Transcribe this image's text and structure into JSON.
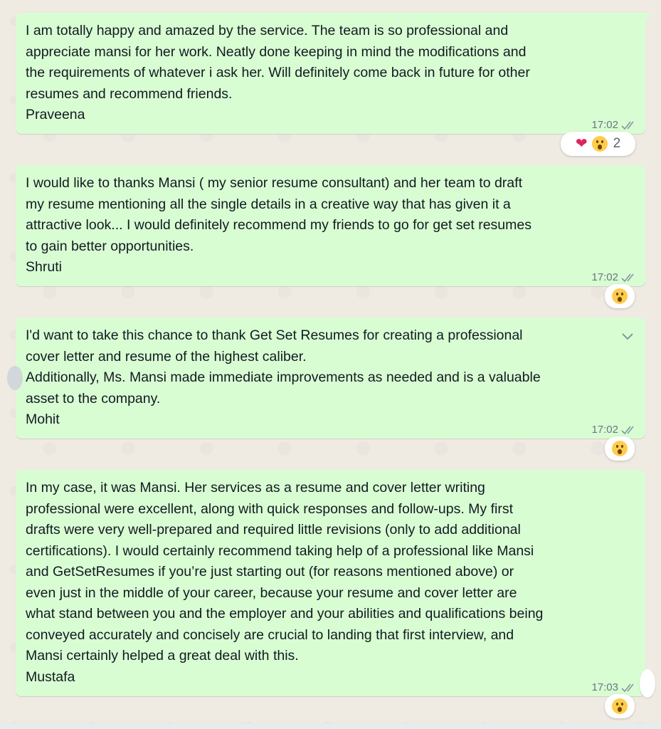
{
  "colors": {
    "bubble_out": "#d9fdd3",
    "chat_background": "#efeae2",
    "meta_text": "#667781",
    "read_tick": "#8696a0"
  },
  "messages": [
    {
      "text": "I am totally happy and amazed by the service. The team is so professional and\nappreciate mansi for her work. Neatly done keeping in mind the modifications and\nthe requirements of whatever i ask her.  Will definitely come back in future for other\nresumes and recommend friends.\nPraveena",
      "time": "17:02",
      "reactions": [
        "heart",
        "wow-face"
      ],
      "reaction_count": "2"
    },
    {
      "text": "I would like to thanks Mansi ( my senior resume consultant) and her team to draft\nmy resume mentioning all the single details in a creative way that has given it a\nattractive look... I would definitely recommend my friends to go for get set resumes\nto gain better opportunities.\nShruti",
      "time": "17:02",
      "reactions": [
        "wow-face"
      ]
    },
    {
      "text": "I'd want to take this chance to thank Get Set Resumes for creating a professional\ncover letter and resume of the highest caliber.\nAdditionally, Ms. Mansi made immediate improvements as needed and is a valuable\nasset to the company.\nMohit",
      "time": "17:02",
      "reactions": [
        "wow-face"
      ]
    },
    {
      "text": "In my case, it was Mansi. Her services as a resume and cover letter writing\nprofessional were excellent, along with quick responses and follow-ups. My first\ndrafts were very well-prepared and required little revisions (only to add additional\ncertifications). I would certainly recommend taking help of a professional like Mansi\nand GetSetResumes if you’re just starting out (for reasons mentioned above) or\neven just in the middle of your career, because your resume and cover letter are\nwhat stand between you and the employer and your abilities and qualifications being\nconveyed accurately and concisely are crucial to landing that first interview, and\nMansi certainly helped a great deal with this.\nMustafa",
      "time": "17:03",
      "reactions": [
        "wow-face"
      ]
    }
  ]
}
